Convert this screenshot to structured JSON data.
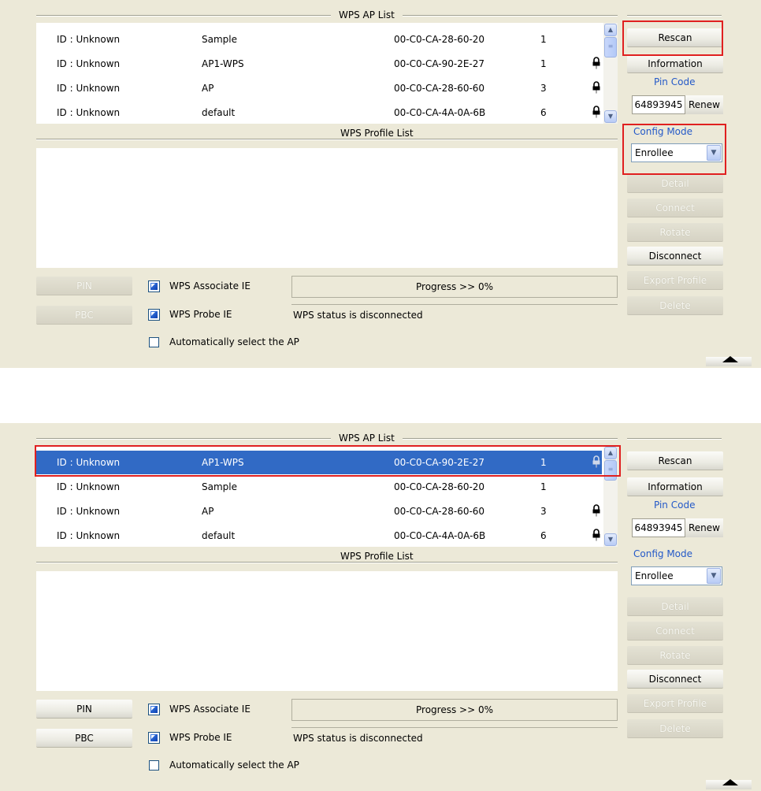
{
  "panels": [
    {
      "ap_list_title": "WPS AP List",
      "profile_list_title": "WPS Profile List",
      "ap_rows": [
        {
          "id": "ID : Unknown",
          "ssid": "Sample",
          "mac": "00-C0-CA-28-60-20",
          "channel": "1",
          "locked": false,
          "selected": false
        },
        {
          "id": "ID : Unknown",
          "ssid": "AP1-WPS",
          "mac": "00-C0-CA-90-2E-27",
          "channel": "1",
          "locked": true,
          "selected": false
        },
        {
          "id": "ID : Unknown",
          "ssid": "AP",
          "mac": "00-C0-CA-28-60-60",
          "channel": "3",
          "locked": true,
          "selected": false
        },
        {
          "id": "ID : Unknown",
          "ssid": "default",
          "mac": "00-C0-CA-4A-0A-6B",
          "channel": "6",
          "locked": true,
          "selected": false
        }
      ],
      "buttons": {
        "rescan": "Rescan",
        "information": "Information",
        "pin_code_label": "Pin Code",
        "pin_code": "64893945",
        "renew": "Renew",
        "config_mode_label": "Config Mode",
        "config_mode": "Enrollee",
        "detail": "Detail",
        "connect": "Connect",
        "rotate": "Rotate",
        "disconnect": "Disconnect",
        "export_profile": "Export Profile",
        "delete": "Delete",
        "pin": "PIN",
        "pbc": "PBC"
      },
      "pin_pbc_enabled": false,
      "checkboxes": {
        "associate_ie": "WPS Associate IE",
        "probe_ie": "WPS Probe IE",
        "auto_select": "Automatically select the AP"
      },
      "progress": "Progress >> 0%",
      "status": "WPS status is disconnected"
    },
    {
      "ap_list_title": "WPS AP List",
      "profile_list_title": "WPS Profile List",
      "ap_rows": [
        {
          "id": "ID : Unknown",
          "ssid": "AP1-WPS",
          "mac": "00-C0-CA-90-2E-27",
          "channel": "1",
          "locked": true,
          "selected": true
        },
        {
          "id": "ID : Unknown",
          "ssid": "Sample",
          "mac": "00-C0-CA-28-60-20",
          "channel": "1",
          "locked": false,
          "selected": false
        },
        {
          "id": "ID : Unknown",
          "ssid": "AP",
          "mac": "00-C0-CA-28-60-60",
          "channel": "3",
          "locked": true,
          "selected": false
        },
        {
          "id": "ID : Unknown",
          "ssid": "default",
          "mac": "00-C0-CA-4A-0A-6B",
          "channel": "6",
          "locked": true,
          "selected": false
        }
      ],
      "buttons": {
        "rescan": "Rescan",
        "information": "Information",
        "pin_code_label": "Pin Code",
        "pin_code": "64893945",
        "renew": "Renew",
        "config_mode_label": "Config Mode",
        "config_mode": "Enrollee",
        "detail": "Detail",
        "connect": "Connect",
        "rotate": "Rotate",
        "disconnect": "Disconnect",
        "export_profile": "Export Profile",
        "delete": "Delete",
        "pin": "PIN",
        "pbc": "PBC"
      },
      "pin_pbc_enabled": true,
      "checkboxes": {
        "associate_ie": "WPS Associate IE",
        "probe_ie": "WPS Probe IE",
        "auto_select": "Automatically select the AP"
      },
      "progress": "Progress >> 0%",
      "status": "WPS status is disconnected"
    }
  ]
}
